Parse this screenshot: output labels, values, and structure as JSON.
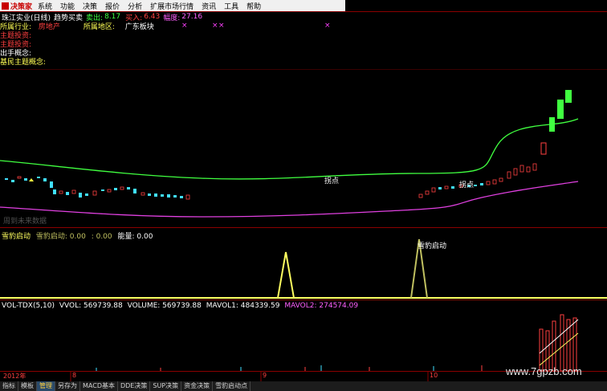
{
  "menubar": {
    "logo_text": "决策家",
    "items": [
      "系统",
      "功能",
      "决策",
      "报价",
      "分析",
      "扩展市场行情",
      "资讯",
      "工具",
      "帮助"
    ]
  },
  "infobar": {
    "title": "珠江实业(日线)",
    "indicator": "趋势买卖",
    "sell_label": "卖出:",
    "sell_value": "8.17",
    "buy_label": "买入:",
    "buy_value": "6.43",
    "amplitude_label": "幅度:",
    "amplitude_value": "27.16"
  },
  "info_rows": {
    "industry_label": "所属行业:",
    "industry_value": "房地产",
    "region_label": "所属地区:",
    "region_value": "广东板块",
    "row2_label": "主题投资:",
    "row3_label": "主题投资:",
    "row4_label": "出手概念:",
    "row5_label": "基民主题概念:"
  },
  "main_chart": {
    "annotation1": "拐点",
    "annotation2": "拐点",
    "future_label": "周到未来数据"
  },
  "panel2": {
    "title": "雪豹启动",
    "label1": "雪豹启动: 0.00",
    "label2": ": 0.00",
    "energy": "能量: 0.00",
    "peak_label": "雪豹启动"
  },
  "panel3": {
    "title": "VOL-TDX(5,10)",
    "vvol": "VVOL: 569739.88",
    "volume": "VOLUME: 569739.88",
    "mavol1": "MAVOL1: 484339.59",
    "mavol2": "MAVOL2: 274574.09"
  },
  "datebar": {
    "year": "2012年",
    "m8": "8",
    "m9": "9",
    "m10": "10"
  },
  "tabs": [
    "指标",
    "模板",
    "管理",
    "另存为",
    "MACD基本",
    "DDE决策",
    "SUP决策",
    "资金决策",
    "雪豹启动点"
  ],
  "watermark": "www.7gpzb.com",
  "colors": {
    "up": "#ff4040",
    "down": "#40e0ff",
    "green_line": "#40ff40",
    "magenta_line": "#e040e0",
    "yellow_line": "#ffff60"
  }
}
